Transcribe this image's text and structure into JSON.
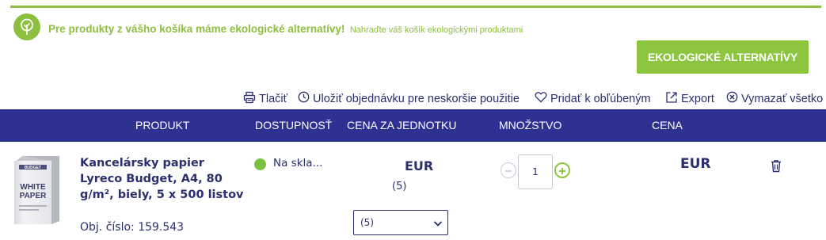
{
  "eco_banner": {
    "title": "Pre produkty z vášho košíka máme ekologické alternatívy!",
    "subtitle": "Nahraďte váš košík ekologickými produktami",
    "button_label": "EKOLOGICKÉ ALTERNATÍVY",
    "icon": "tree-icon",
    "accent_color": "#8cc63f"
  },
  "actions": {
    "print": {
      "label": "Tlačiť",
      "icon": "printer-icon"
    },
    "save": {
      "label": "Uložiť objednávku pre neskoršie použitie",
      "icon": "clock-icon"
    },
    "favorite": {
      "label": "Pridať k obľúbeným",
      "icon": "heart-icon"
    },
    "export": {
      "label": "Export",
      "icon": "export-icon"
    },
    "clear": {
      "label": "Vymazať všetko",
      "icon": "close-circle-icon"
    }
  },
  "table": {
    "header_color": "#2e3192",
    "columns": {
      "product": "PRODUKT",
      "availability": "DOSTUPNOSŤ",
      "unit_price": "CENA ZA JEDNOTKU",
      "quantity": "MNOŽSTVO",
      "price": "CENA"
    }
  },
  "item": {
    "image_text_brand": "BUDGET",
    "image_text_main_1": "WHITE",
    "image_text_main_2": "PAPER",
    "name": "Kancelársky papier Lyreco Budget, A4, 80 g/m², biely, 5 x 500 listov",
    "object_number": "Obj. číslo: 159.543",
    "availability": "Na skla...",
    "availability_color": "#7bc143",
    "unit_price": "EUR",
    "unit_count": "(5)",
    "unit_select_value": "(5)",
    "quantity": "1",
    "total_price": "EUR",
    "delete_icon": "trash-icon"
  }
}
